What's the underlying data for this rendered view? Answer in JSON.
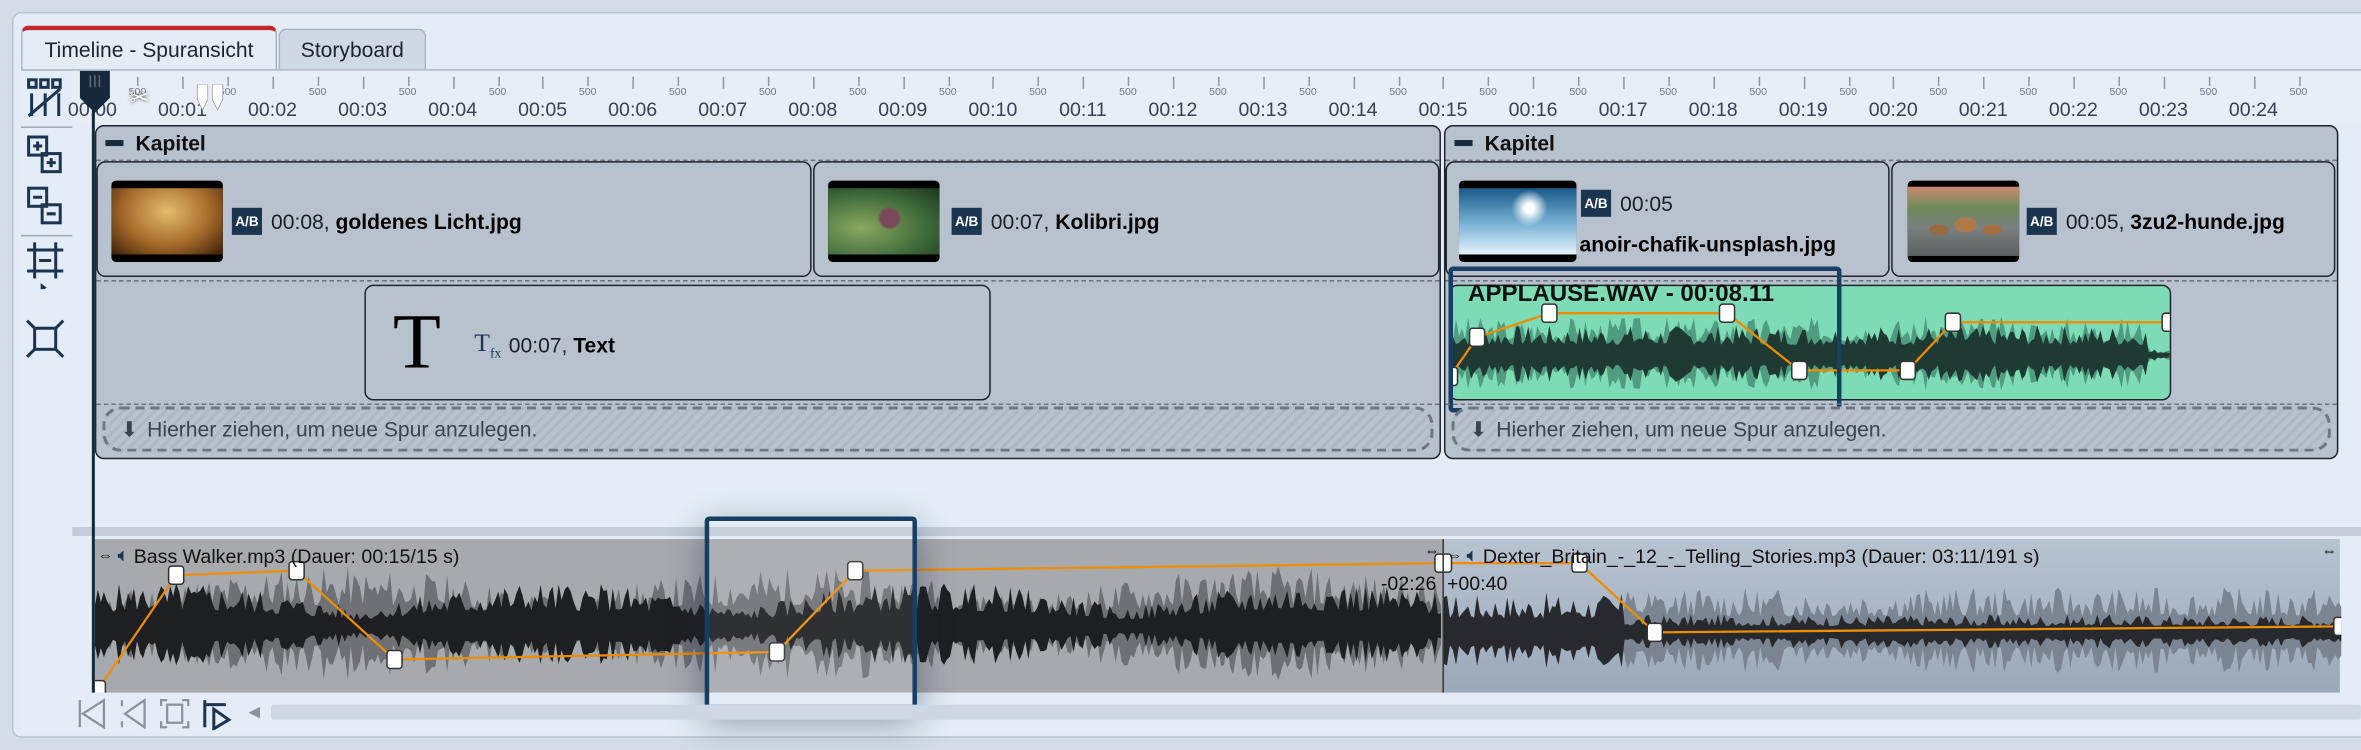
{
  "tabs": [
    {
      "label": "Timeline - Spuransicht",
      "active": true
    },
    {
      "label": "Storyboard",
      "active": false
    }
  ],
  "toolbar": {
    "icons": [
      "split-tracks-icon",
      "add-track-icon",
      "remove-track-icon",
      "fit-frame-icon",
      "fit-all-icon"
    ]
  },
  "ruler": {
    "labels": [
      "00:00",
      "00:01",
      "00:02",
      "00:03",
      "00:04",
      "00:05",
      "00:06",
      "00:07",
      "00:08",
      "00:09",
      "00:10",
      "00:11",
      "00:12",
      "00:13",
      "00:14",
      "00:15",
      "00:16",
      "00:17",
      "00:18",
      "00:19",
      "00:20",
      "00:21",
      "00:22",
      "00:23",
      "00:24"
    ],
    "half_label": "500"
  },
  "chapters": [
    {
      "title": "Kapitel",
      "clips": [
        {
          "duration": "00:08,",
          "name": "goldenes Licht.jpg"
        },
        {
          "duration": "00:07,",
          "name": "Kolibri.jpg"
        }
      ],
      "text_clip": {
        "duration": "00:07,",
        "name": "Text",
        "glyph": "T"
      },
      "drop_hint": "Hierher ziehen, um neue Spur anzulegen."
    },
    {
      "title": "Kapitel",
      "clips": [
        {
          "duration": "00:05",
          "name": "anoir-chafik-unsplash.jpg"
        },
        {
          "duration": "00:05,",
          "name": "3zu2-hunde.jpg"
        }
      ],
      "audio_clip": {
        "label": "APPLAUSE.WAV - 00:08.11"
      },
      "drop_hint": "Hierher ziehen, um neue Spur anzulegen."
    }
  ],
  "audio_track": {
    "clips": [
      {
        "title": "Bass Walker.mp3 (Dauer: 00:15/15 s)"
      },
      {
        "title": "Dexter_Britain_-_12_-_Telling_Stories.mp3 (Dauer: 03:11/191 s)"
      }
    ],
    "offset_left": "-02:26",
    "offset_right": "+00:40"
  },
  "bottom_nav": {
    "icons": [
      "go-start-icon",
      "previous-marker-icon",
      "fit-view-icon",
      "play-from-cursor-icon"
    ]
  },
  "colors": {
    "accent_tab": "#c1272d",
    "selection": "#173e63",
    "envelope": "#f08c00",
    "applause_clip": "#7ddbb5",
    "clip_bg": "#b8c2cf"
  }
}
